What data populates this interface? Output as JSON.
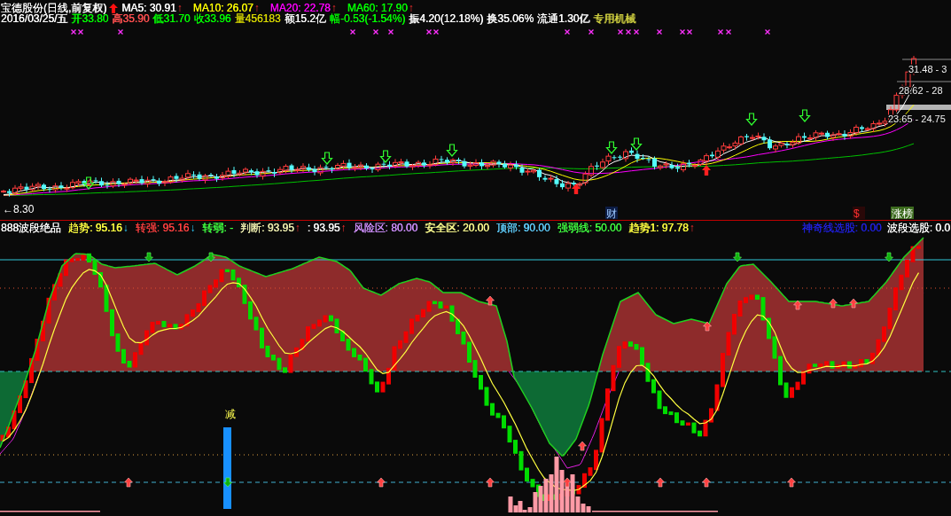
{
  "quote_header": {
    "title": "宝德股份(日线,前复权)",
    "moving_averages": [
      {
        "label": "MA5: 30.91",
        "arrow": "↑",
        "rising": true,
        "color": "#ffffff"
      },
      {
        "label": "MA10: 26.07",
        "arrow": "↑",
        "rising": true,
        "color": "#ffff00"
      },
      {
        "label": "MA20: 22.78",
        "arrow": "↑",
        "rising": true,
        "color": "#ff00ff"
      },
      {
        "label": "MA60: 17.90",
        "arrow": "↑",
        "rising": true,
        "color": "#00ff00"
      }
    ]
  },
  "quote_line": {
    "date": "2016/03/25/五",
    "fields": [
      {
        "text": "开33.80",
        "color": "#00ff00"
      },
      {
        "text": "高35.90",
        "color": "#ff5050"
      },
      {
        "text": "低31.70",
        "color": "#00ff00"
      },
      {
        "text": "收33.96",
        "color": "#00ff00"
      },
      {
        "text": "量456183",
        "color": "#d8d800"
      },
      {
        "text": "额15.2亿",
        "color": "#ffffff"
      },
      {
        "text": "幅-0.53(-1.54%)",
        "color": "#00ff00"
      },
      {
        "text": "振4.20(12.18%)",
        "color": "#ffffff"
      },
      {
        "text": "换35.06%",
        "color": "#ffffff"
      },
      {
        "text": "流通1.30亿",
        "color": "#ffffff"
      }
    ],
    "sector": "专用机械"
  },
  "price_chart": {
    "level_labels": [
      "31.48 - 3",
      "28.62 - 28",
      "23.65 - 24.75"
    ],
    "low_label": "←8.30",
    "event_marks": [
      {
        "kind": "finance",
        "text": "财"
      },
      {
        "kind": "dividend",
        "text": "$"
      },
      {
        "kind": "ranking",
        "text": "涨榜"
      }
    ]
  },
  "indicator": {
    "name": "888波段绝品",
    "values": [
      {
        "label": "趋势: 95.16",
        "arrow": "↓",
        "rising": false,
        "color": "#ffff40"
      },
      {
        "label": "转强: 95.16",
        "arrow": "↓",
        "rising": false,
        "color": "#ff4040"
      },
      {
        "label": "转弱: -",
        "color": "#40ff40"
      },
      {
        "label": "判断: 93.95",
        "arrow": "↑",
        "rising": true,
        "color": "#f0f0b0"
      },
      {
        "label": ": 93.95",
        "arrow": "↑",
        "rising": true,
        "color": "#ffffff"
      },
      {
        "label": "风险区: 80.00",
        "color": "#d090ff"
      },
      {
        "label": "安全区: 20.00",
        "color": "#ffff90"
      },
      {
        "label": "顶部: 90.00",
        "color": "#60d0ff"
      },
      {
        "label": "强弱线: 50.00",
        "color": "#40ff40"
      },
      {
        "label": "趋势1: 97.78",
        "arrow": "↑",
        "rising": true,
        "color": "#ffff40"
      }
    ],
    "picks": [
      {
        "label": "神奇线选股: 0.00",
        "color": "#2020e0"
      },
      {
        "label": "波段选股: 0.0",
        "color": "#ffffff"
      }
    ],
    "signal_label": "减"
  }
}
